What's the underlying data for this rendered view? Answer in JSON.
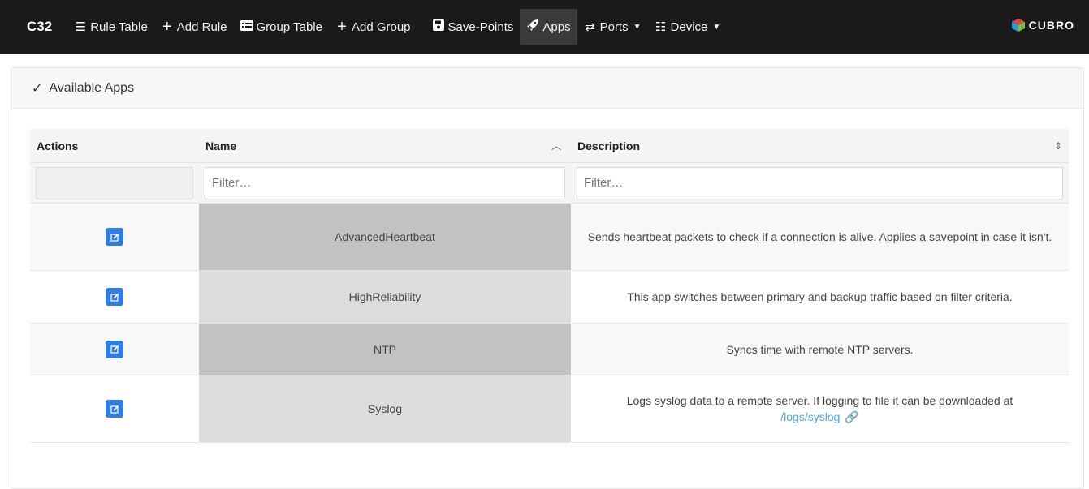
{
  "navbar": {
    "brand": "C32",
    "items": [
      {
        "label": "Rule Table",
        "icon": "list-icon"
      },
      {
        "label": "Add Rule",
        "icon": "plus-icon"
      },
      {
        "label": "Group Table",
        "icon": "table-icon"
      },
      {
        "label": "Add Group",
        "icon": "plus-icon"
      },
      {
        "label": "Save-Points",
        "icon": "save-icon"
      },
      {
        "label": "Apps",
        "icon": "rocket-icon",
        "active": true
      },
      {
        "label": "Ports",
        "icon": "swap-icon",
        "dropdown": true
      },
      {
        "label": "Device",
        "icon": "checklist-icon",
        "dropdown": true
      }
    ],
    "logo_text": "CUBRO"
  },
  "card": {
    "title": "Available Apps"
  },
  "table": {
    "headers": {
      "actions": "Actions",
      "name": "Name",
      "description": "Description"
    },
    "filter_placeholder_name": "Filter…",
    "filter_placeholder_desc": "Filter…",
    "rows": [
      {
        "name": "AdvancedHeartbeat",
        "description": "Sends heartbeat packets to check if a connection is alive. Applies a savepoint in case it isn't."
      },
      {
        "name": "HighReliability",
        "description": "This app switches between primary and backup traffic based on filter criteria."
      },
      {
        "name": "NTP",
        "description": "Syncs time with remote NTP servers."
      },
      {
        "name": "Syslog",
        "description": "Logs syslog data to a remote server. If logging to file it can be downloaded at",
        "link": "/logs/syslog"
      }
    ]
  },
  "colors": {
    "navbar_bg": "#1a1a1a",
    "edit_button": "#2f7de1",
    "link": "#4aa6e0"
  }
}
